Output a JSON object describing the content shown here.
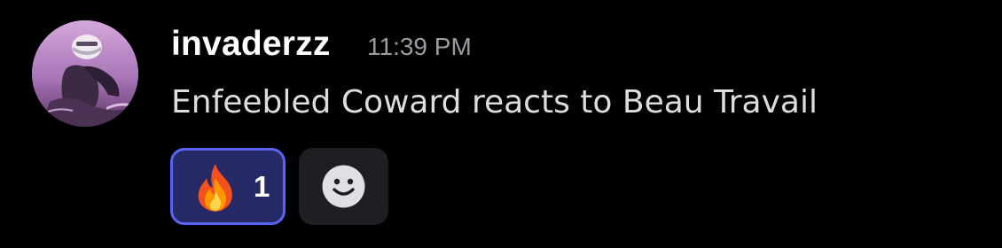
{
  "message": {
    "author": "invaderzz",
    "timestamp": "11:39 PM",
    "content": "Enfeebled Coward reacts to Beau Travail"
  },
  "reactions": [
    {
      "emoji": "fire-icon",
      "count": "1",
      "selected": true
    }
  ],
  "add_reaction": {
    "icon": "smiley-face-icon"
  },
  "colors": {
    "background": "#000000",
    "author": "#ffffff",
    "timestamp": "#9a9ca3",
    "content": "#dbdee1",
    "reaction_selected_bg": "#252966",
    "reaction_selected_border": "#5865f2",
    "button_bg": "#1e1f22"
  }
}
